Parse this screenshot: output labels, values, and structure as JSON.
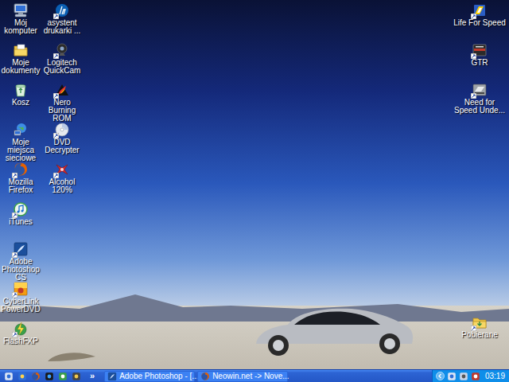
{
  "desktop": {
    "left_columns": [
      [
        {
          "label": "Mój komputer",
          "shortcut": false
        },
        {
          "label": "Moje dokumenty",
          "shortcut": false
        },
        {
          "label": "Kosz",
          "shortcut": false
        },
        {
          "label": "Moje miejsca sieciowe",
          "shortcut": false
        },
        {
          "label": "Mozilla Firefox",
          "shortcut": true
        },
        {
          "label": "iTunes",
          "shortcut": true
        },
        {
          "label": "Adobe Photoshop CS",
          "shortcut": true
        },
        {
          "label": "CyberLink PowerDVD",
          "shortcut": true
        },
        {
          "label": "FlashFXP",
          "shortcut": true
        }
      ],
      [
        {
          "label": "asystent drukarki ...",
          "shortcut": true
        },
        {
          "label": "Logitech QuickCam",
          "shortcut": true
        },
        {
          "label": "Nero Burning ROM",
          "shortcut": true
        },
        {
          "label": "DVD Decrypter",
          "shortcut": true
        },
        {
          "label": "Alcohol 120%",
          "shortcut": true
        }
      ]
    ],
    "right_top": [
      {
        "label": "Life For Speed",
        "shortcut": true
      },
      {
        "label": "GTR",
        "shortcut": true
      },
      {
        "label": "Need for Speed Unde...",
        "shortcut": true
      }
    ],
    "right_bottom": [
      {
        "label": "Pobierane",
        "shortcut": true
      }
    ]
  },
  "taskbar": {
    "quick_launch_more": "»",
    "tasks": [
      {
        "label": "Adobe Photoshop - [...",
        "selected": false
      },
      {
        "label": "Neowin.net -> Nove...",
        "selected": false
      }
    ],
    "clock": "03:19"
  }
}
